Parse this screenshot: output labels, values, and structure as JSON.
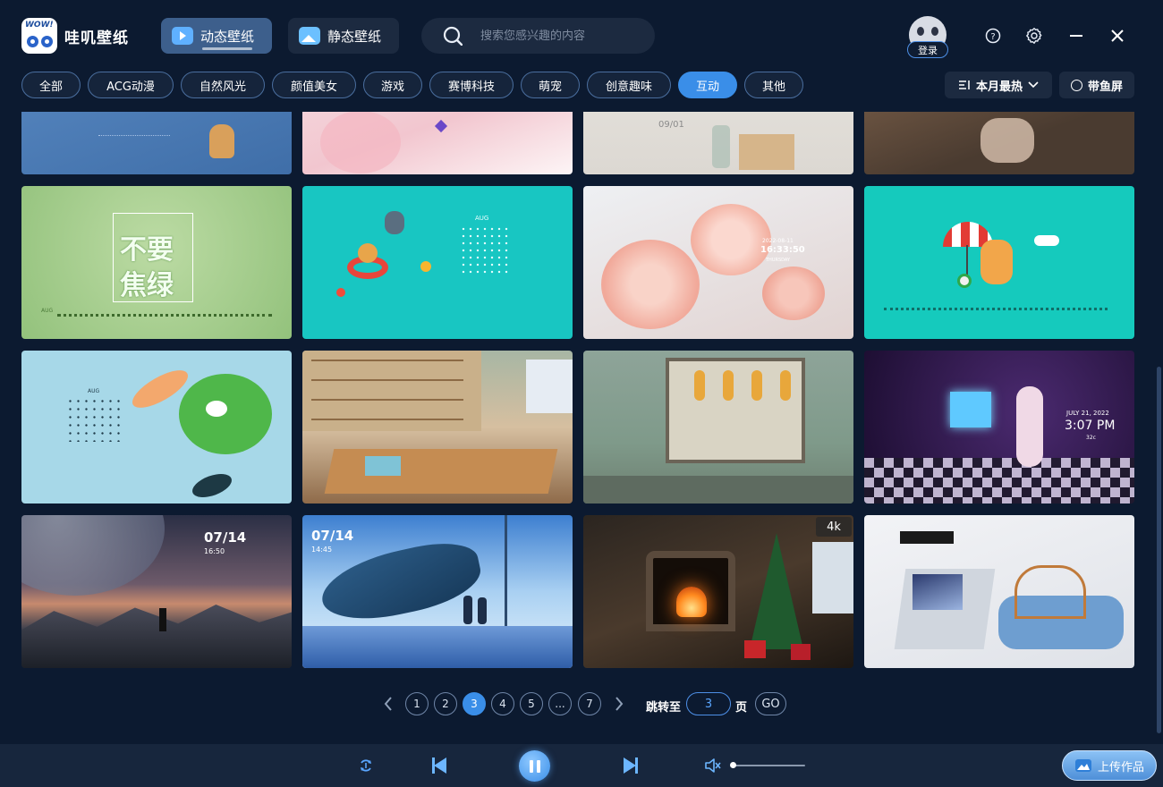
{
  "app": {
    "name": "哇叽壁纸",
    "logo_text": "WOW!"
  },
  "mode_tabs": [
    {
      "label": "动态壁纸",
      "active": true
    },
    {
      "label": "静态壁纸",
      "active": false
    }
  ],
  "search": {
    "placeholder": "搜索您感兴趣的内容"
  },
  "user": {
    "login_label": "登录"
  },
  "header_icons": [
    "help-icon",
    "settings-icon",
    "minimize-icon",
    "close-icon"
  ],
  "categories": [
    {
      "label": "全部",
      "active": false
    },
    {
      "label": "ACG动漫",
      "active": false
    },
    {
      "label": "自然风光",
      "active": false
    },
    {
      "label": "颜值美女",
      "active": false
    },
    {
      "label": "游戏",
      "active": false
    },
    {
      "label": "赛博科技",
      "active": false
    },
    {
      "label": "萌宠",
      "active": false
    },
    {
      "label": "创意趣味",
      "active": false
    },
    {
      "label": "互动",
      "active": true
    },
    {
      "label": "其他",
      "active": false
    }
  ],
  "sort": {
    "label": "本月最热"
  },
  "fish_screen": {
    "label": "带鱼屏"
  },
  "wallpapers": {
    "row0": [
      {
        "name": "shiba-calendar-blue"
      },
      {
        "name": "anime-girl-flowers"
      },
      {
        "name": "desk-vase-box",
        "date": "09/01"
      },
      {
        "name": "room-figure"
      }
    ],
    "row1": [
      {
        "name": "buyao-jiaolv-green",
        "line1": "不要",
        "line2": "焦绿",
        "month": "AUG"
      },
      {
        "name": "shiba-swim-teal",
        "month": "AUG"
      },
      {
        "name": "pink-flowers-clock",
        "time": "16:33:50",
        "date": "2022-08-11",
        "weekday": "THURSDAY"
      },
      {
        "name": "shiba-beach-teal"
      }
    ],
    "row2": [
      {
        "name": "koi-lotus",
        "month": "AUG"
      },
      {
        "name": "anime-classroom"
      },
      {
        "name": "cozy-room-lanterns"
      },
      {
        "name": "gamer-girl-neon",
        "date": "JULY 21, 2022",
        "time": "3:07 PM",
        "temp": "32c"
      }
    ],
    "row3": [
      {
        "name": "mountain-planet",
        "date": "07/14",
        "time": "16:50"
      },
      {
        "name": "whale-sky",
        "date": "07/14",
        "time": "14:45"
      },
      {
        "name": "christmas-fireplace",
        "badge": "4k"
      },
      {
        "name": "white-room-chairs"
      }
    ]
  },
  "pagination": {
    "pages": [
      "1",
      "2",
      "3",
      "4",
      "5",
      "...",
      "7"
    ],
    "current": "3",
    "jump_label": "跳转至",
    "jump_value": "3",
    "page_label": "页",
    "go_label": "GO"
  },
  "player": {
    "upload_label": "上传作品",
    "volume": 0.0
  },
  "colors": {
    "background": "#0c1a30",
    "accent": "#3a8ee8",
    "panel": "#1c2a40"
  }
}
